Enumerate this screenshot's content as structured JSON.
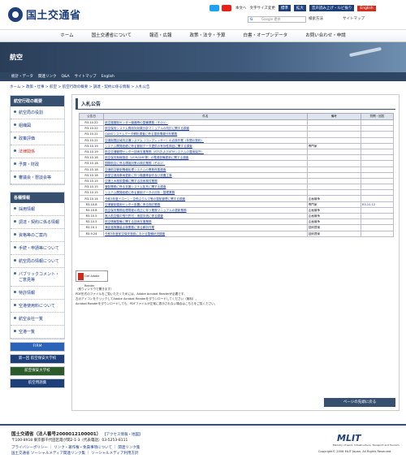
{
  "header": {
    "site_name": "国土交通省",
    "tools": [
      "本文へ",
      "文字サイズ変更",
      "標準",
      "拡大",
      "音声読み上げ・ルビ振り",
      "English"
    ],
    "search_placeholder": "Google 提供",
    "search_button": "検索方法",
    "sitemap": "サイトマップ"
  },
  "nav": [
    "ホーム",
    "国土交通省について",
    "報道・広報",
    "政策・法令・予算",
    "白書・オープンデータ",
    "お問い合わせ・申請"
  ],
  "banner_title": "航空",
  "subnav": [
    "統計・データ",
    "関連リンク",
    "Q&A",
    "サイトマップ",
    "English"
  ],
  "breadcrumb": "ホーム > 政策・仕事 > 航空 > 航空行政の概要 > 調達・契約に係る情報 > 入札公告",
  "sidebar": {
    "head1": "航空行政の概要",
    "items1": [
      "航空局の役割",
      "組織図",
      "政策評価",
      "法律関係",
      "予算・財政",
      "審議会・懇談会等"
    ],
    "head2": "各種情報",
    "items2": [
      "採用情報",
      "調達・契約に係る情報",
      "資格等のご案内",
      "手続・申請等について",
      "航空局の情報について",
      "パブリックコメント・ご意見等",
      "特許情報",
      "空港使用料について",
      "航空会社一覧",
      "空港一覧"
    ],
    "banners": [
      "FIRM",
      "第一回 航空保安大学校",
      "航空保安大学校",
      "航空用語集"
    ]
  },
  "main": {
    "title": "入札公告",
    "headers": [
      "公告日",
      "件名",
      "備考",
      "質問・回答"
    ],
    "rows": [
      [
        "R3.10.22",
        "航空路管制センター機器等の整備業務（その1）",
        "",
        ""
      ],
      [
        "R3.10.22",
        "航空保安システム費用対効果分析マニュアルの改訂に関する調査",
        "",
        ""
      ],
      [
        "R3.10.21",
        "GANSシステムデータ解析調査に係る運航情報分析業務",
        "",
        ""
      ],
      [
        "R3.10.21",
        "空港制限区域内交通システム（コンプレッサー）の点検作業（年間の契約）",
        "",
        "",
        ""
      ],
      [
        "R3.10.19",
        "システム開発経緯に係る管制データ提供の有効性検証に関する調査",
        "専門家",
        ""
      ],
      [
        "R3.10.19",
        "航空交通管理センター技術支援業務（ATSおよびATMシステムの運用保守）",
        "",
        ""
      ],
      [
        "R3.10.18",
        "航空保安無線施設（VOR/DME等）の電源設備更新に関する調査",
        "",
        ""
      ],
      [
        "R3.10.18",
        "国際航空に係る環境対策の検討業務（その2）",
        "",
        ""
      ],
      [
        "R3.10.18",
        "空港航空管制情報処理システムの業務改善調査",
        "",
        ""
      ],
      [
        "R3.10.18",
        "新型空港用車両更新に伴う機器等製作及び設置工事",
        "",
        ""
      ],
      [
        "R3.10.15",
        "空港土木施設整備に関する技術検討業務",
        "",
        ""
      ],
      [
        "R3.10.15",
        "管制業務に係る支援システム拡充に関する調査",
        "",
        ""
      ],
      [
        "R3.10.15",
        "システム開発経緯に係る管制データの分析・整理業務",
        "",
        ""
      ],
      [
        "R3.10.14",
        "令和3年度ドローン・空飛ぶクルマ等の運航管理に関する調査",
        "企画競争",
        ""
      ],
      [
        "R3.10.8",
        "空港管制運用センター設置に係る検討業務",
        "専門家",
        "R3.10.12"
      ],
      [
        "R3.10.8",
        "航空保安業務処理規程の改正に伴う業務マニュアルの更新業務",
        "企画競争",
        ""
      ],
      [
        "R3.10.5",
        "無人航空機の飛行許可・承認手続に係る調査",
        "企画競争",
        ""
      ],
      [
        "R3.10.5",
        "航空情報整備に関する技術支援業務",
        "企画競争",
        ""
      ],
      [
        "R3.10.1",
        "滑走路等舗装点検業務に係る解析作業",
        "技術提案",
        ""
      ],
      [
        "R3.9.24",
        "令和3年度航空保安施設における整備状況調査",
        "技術提案",
        ""
      ]
    ],
    "adobe": "Get Adobe Reader",
    "notes": [
      "（別ウィンドウで開きます）",
      "PDF形式のファイルをご覧いただくためには、Adobe Acrobat Readerが必要です。",
      "左のアイコンをクリックしてAdobe Acrobat Readerをダウンロードしてください（無料）。",
      "Acrobat Readerをダウンロードしても、PDFファイルが正常に表示されない場合はこちらをご覧ください。"
    ],
    "pagetop": "ページの先頭に戻る"
  },
  "footer": {
    "name": "国土交通省（法人番号2000012100001）",
    "access": "【アクセス情報・地図】",
    "address": "〒100-8918 東京都千代田区霞が関2-1-3（代表電話）03-5253-8111",
    "links1": "プライバシーポリシー ｜ リンク・著作権・免責事項について ｜ 関連リンク集",
    "links2": "国土交通省 ソーシャルメディア関連リンク集 ｜ ソーシャルメディア利用方針",
    "mlit": "MLIT",
    "mlit_sub": "Ministry of Land, Infrastructure, Transport and Tourism",
    "copyright": "Copyright© 2006 MLIT Japan. All Rights Reserved."
  },
  "colors": {
    "navy": "#37506f",
    "link": "#1a3a8a"
  }
}
